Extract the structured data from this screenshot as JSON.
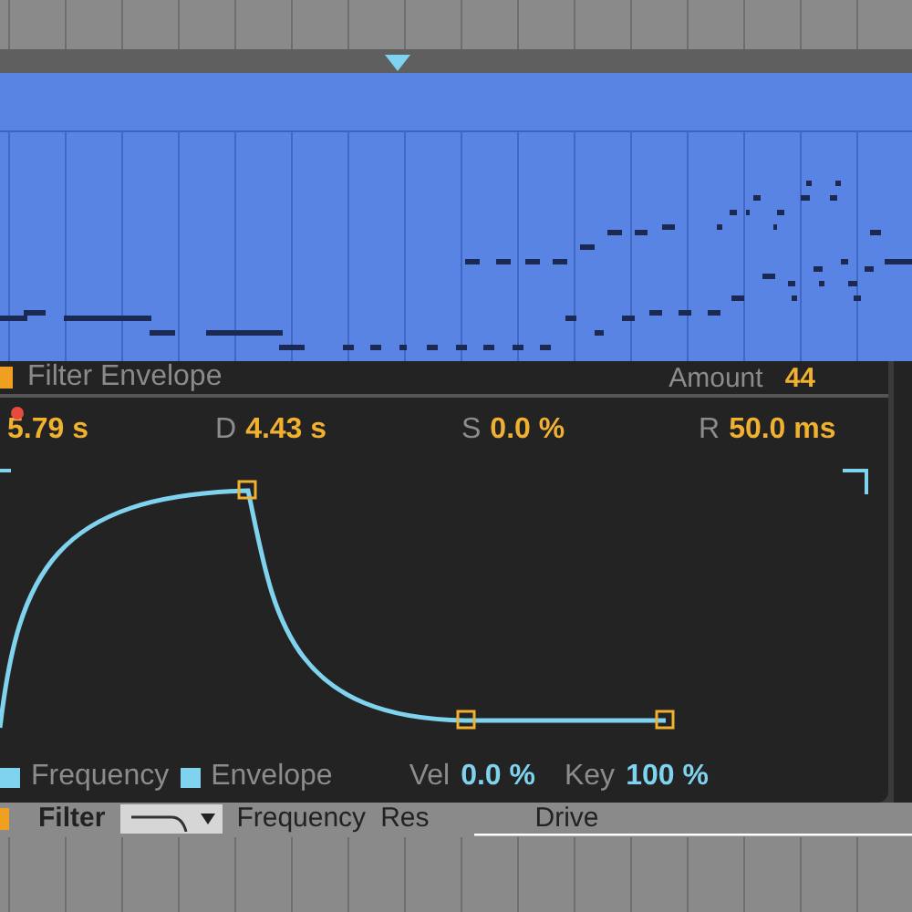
{
  "device": {
    "title": "Filter Envelope",
    "amount": {
      "label": "Amount",
      "value": "44"
    },
    "stages": [
      {
        "value": "5.79 s"
      },
      {
        "label": "D",
        "value": "4.43 s"
      },
      {
        "label": "S",
        "value": "0.0 %"
      },
      {
        "label": "R",
        "value": "50.0 ms"
      }
    ],
    "legend": [
      {
        "label": "Frequency"
      },
      {
        "label": "Envelope"
      }
    ],
    "modifiers": [
      {
        "label": "Vel",
        "value": "0.0 %"
      },
      {
        "label": "Key",
        "value": "100 %"
      }
    ]
  },
  "filter_row": {
    "label": "Filter",
    "columns": [
      "Frequency",
      "Res",
      "Drive"
    ]
  }
}
